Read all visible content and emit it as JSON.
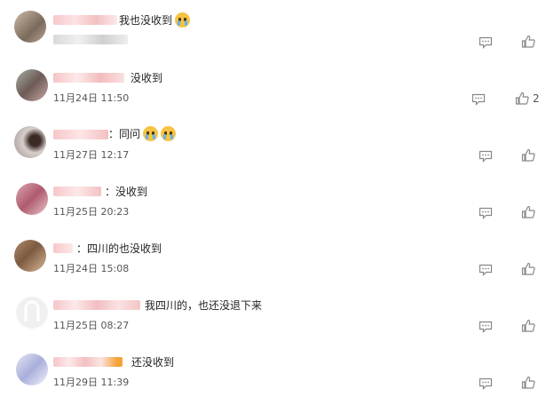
{
  "comments": [
    {
      "text": "我也没收到",
      "emoji_count": 1,
      "date": "",
      "likes": ""
    },
    {
      "text": "没收到",
      "emoji_count": 0,
      "date": "11月24日 11:50",
      "likes": "2"
    },
    {
      "text": "：同问",
      "emoji_count": 2,
      "date": "11月27日 12:17",
      "likes": ""
    },
    {
      "text": "：没收到",
      "emoji_count": 0,
      "date": "11月25日 20:23",
      "likes": ""
    },
    {
      "text": "：四川的也没收到",
      "emoji_count": 0,
      "date": "11月24日 15:08",
      "likes": ""
    },
    {
      "text": "我四川的，也还没退下来",
      "emoji_count": 0,
      "date": "11月25日 08:27",
      "likes": ""
    },
    {
      "text": "还没收到",
      "emoji_count": 0,
      "date": "11月29日 11:39",
      "likes": ""
    }
  ],
  "icons": {
    "reply": "comment-icon",
    "like": "thumbs-up-icon",
    "emoji": "crying-face-emoji"
  },
  "colors": {
    "text": "#222222",
    "meta": "#555555",
    "icon": "#888888"
  }
}
